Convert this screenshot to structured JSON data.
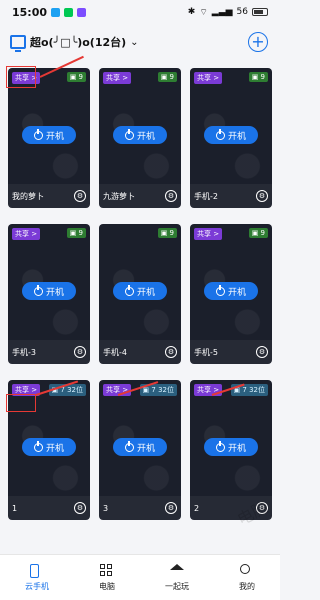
{
  "status": {
    "time": "15:00",
    "network": "56",
    "battery": ""
  },
  "header": {
    "title": "超o(╯□╰)o(12台)",
    "chevron": "⌄",
    "add": "+"
  },
  "cards": [
    {
      "share": "共享 >",
      "count": "9",
      "power": "开机",
      "name": "我的萝卜"
    },
    {
      "share": "共享 >",
      "count": "9",
      "power": "开机",
      "name": "九游萝卜"
    },
    {
      "share": "共享 >",
      "count": "9",
      "power": "开机",
      "name": "手机-2"
    },
    {
      "share": "共享 >",
      "count": "9",
      "power": "开机",
      "name": "手机-3"
    },
    {
      "share": "",
      "count": "9",
      "power": "开机",
      "name": "手机-4"
    },
    {
      "share": "共享 >",
      "count": "9",
      "power": "开机",
      "name": "手机-5"
    },
    {
      "share": "共享 >",
      "count": "7",
      "tag": "32位",
      "power": "开机",
      "name": "1"
    },
    {
      "share": "共享 >",
      "count": "7",
      "tag": "32位",
      "power": "开机",
      "name": "3"
    },
    {
      "share": "共享 >",
      "count": "7",
      "tag": "32位",
      "power": "开机",
      "name": "2"
    }
  ],
  "tabs": [
    {
      "label": "云手机",
      "icon": "phone-icon",
      "active": true
    },
    {
      "label": "电脑",
      "icon": "pc-icon",
      "active": false
    },
    {
      "label": "一起玩",
      "icon": "home-icon",
      "active": false
    },
    {
      "label": "我的",
      "icon": "user-icon",
      "active": false
    }
  ],
  "watermark": "电脑"
}
